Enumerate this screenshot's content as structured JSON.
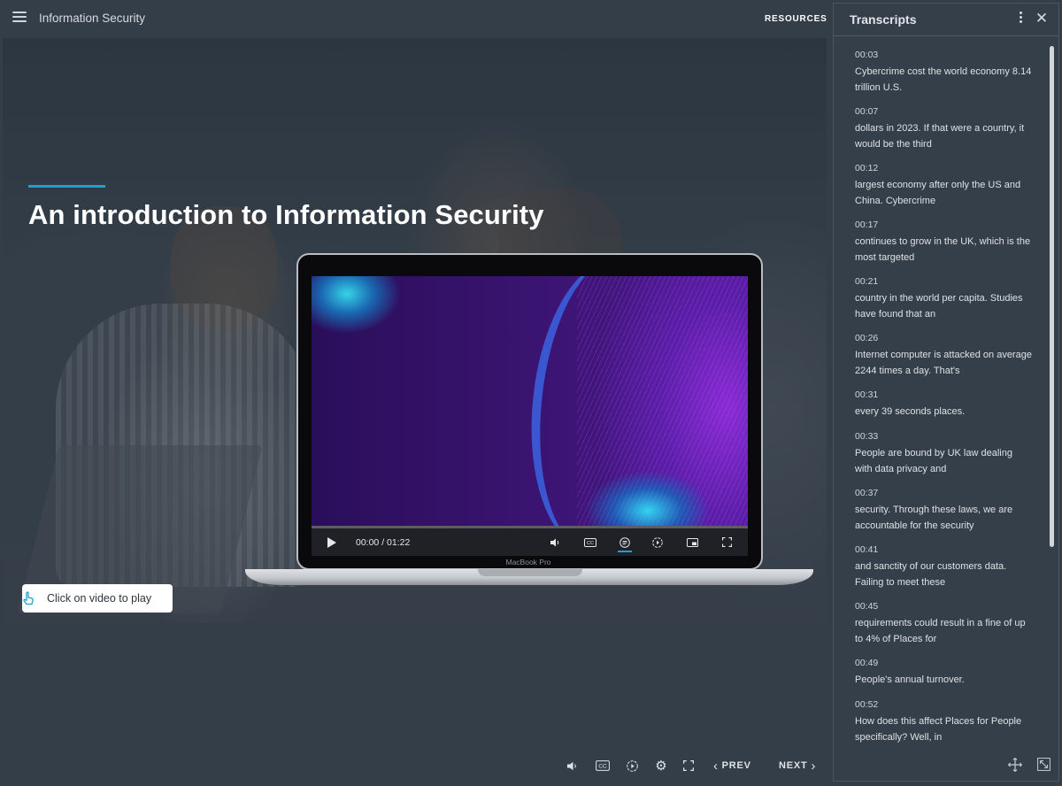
{
  "header": {
    "course_title": "Information Security",
    "resources_label": "RESOURCES"
  },
  "slide": {
    "headline": "An introduction to Information Security",
    "hint_text": "Click on video to play"
  },
  "video": {
    "time": "00:00 / 01:22",
    "brand": "MacBook Pro",
    "progress": 0
  },
  "footer": {
    "prev_label": "PREV",
    "next_label": "NEXT"
  },
  "transcripts": {
    "title": "Transcripts",
    "entries": [
      {
        "time": "00:03",
        "text": "Cybercrime cost the world economy 8.14 trillion U.S."
      },
      {
        "time": "00:07",
        "text": "dollars in 2023. If that were a country, it would be the third"
      },
      {
        "time": "00:12",
        "text": "largest economy after only the US and China. Cybercrime"
      },
      {
        "time": "00:17",
        "text": "continues to grow in the UK, which is the most targeted"
      },
      {
        "time": "00:21",
        "text": "country in the world per capita. Studies have found that an"
      },
      {
        "time": "00:26",
        "text": "Internet computer is attacked on average 2244 times a day. That's"
      },
      {
        "time": "00:31",
        "text": "every 39 seconds places."
      },
      {
        "time": "00:33",
        "text": "People are bound by UK law dealing with data privacy and"
      },
      {
        "time": "00:37",
        "text": "security. Through these laws, we are accountable for the security"
      },
      {
        "time": "00:41",
        "text": "and sanctity of our customers data. Failing to meet these"
      },
      {
        "time": "00:45",
        "text": "requirements could result in a fine of up to 4% of Places for"
      },
      {
        "time": "00:49",
        "text": "People's annual turnover."
      },
      {
        "time": "00:52",
        "text": "How does this affect Places for People specifically? Well, in"
      }
    ]
  },
  "colors": {
    "accent": "#1c9fd6",
    "background": "#343e48",
    "panel": "#353f49"
  },
  "icons": {
    "menu": "hamburger-icon",
    "play": "play-icon",
    "volume": "volume-icon",
    "captions": "cc-icon",
    "transcript": "transcript-icon",
    "speed": "speed-icon",
    "pip": "picture-in-picture-icon",
    "fullscreen": "fullscreen-icon",
    "settings": "gear-icon",
    "kebab": "kebab-icon",
    "close": "close-icon",
    "move": "move-icon",
    "resize": "resize-icon",
    "hint": "tap-hand-icon"
  }
}
